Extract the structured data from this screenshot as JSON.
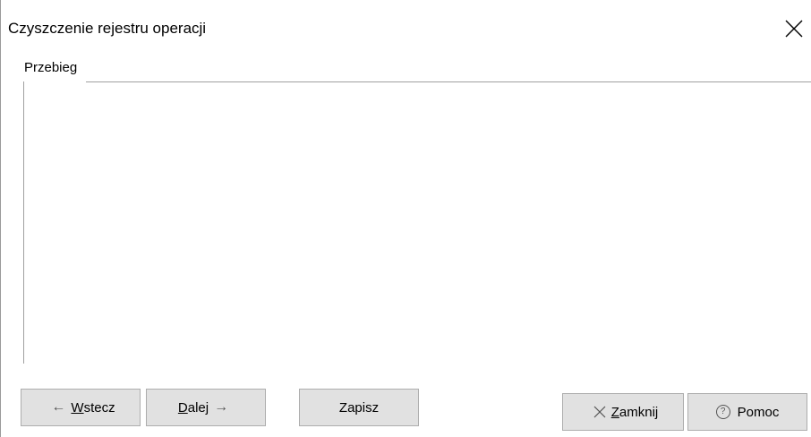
{
  "window": {
    "title": "Czyszczenie rejestru operacji"
  },
  "group": {
    "label": "Przebieg"
  },
  "buttons": {
    "back": {
      "pre": "",
      "accel": "W",
      "rest": "stecz",
      "icon": "arrow-left-icon"
    },
    "next": {
      "accel": "D",
      "rest": "alej",
      "icon": "arrow-right-icon"
    },
    "save": {
      "label": "Zapisz"
    },
    "close": {
      "accel": "Z",
      "rest": "amknij",
      "icon": "close-icon"
    },
    "help": {
      "label": "Pomoc",
      "icon": "help-circle-icon"
    }
  }
}
